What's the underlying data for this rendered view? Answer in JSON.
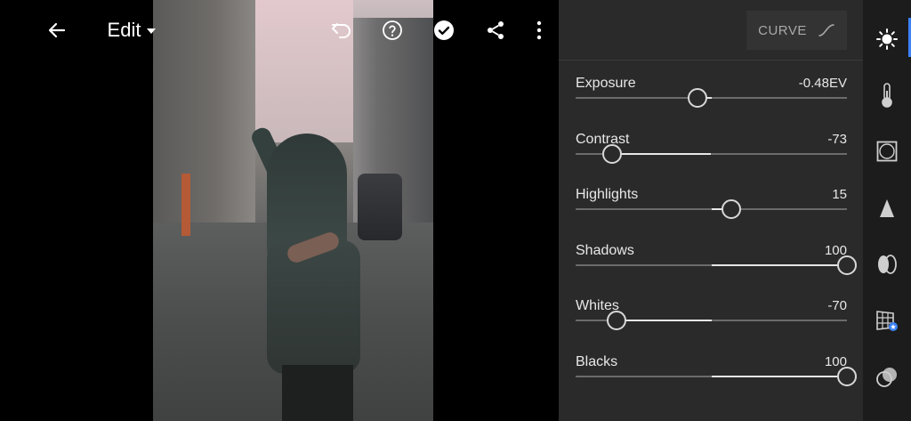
{
  "topbar": {
    "mode_label": "Edit"
  },
  "panel": {
    "curve_label": "CURVE",
    "sliders": [
      {
        "label": "Exposure",
        "value_text": "-0.48EV",
        "position": 0.45
      },
      {
        "label": "Contrast",
        "value_text": "-73",
        "position": 0.135
      },
      {
        "label": "Highlights",
        "value_text": "15",
        "position": 0.575
      },
      {
        "label": "Shadows",
        "value_text": "100",
        "position": 1.0
      },
      {
        "label": "Whites",
        "value_text": "-70",
        "position": 0.15
      },
      {
        "label": "Blacks",
        "value_text": "100",
        "position": 1.0
      }
    ]
  },
  "tools": [
    {
      "name": "light-icon",
      "active": true
    },
    {
      "name": "color-temperature-icon",
      "active": false
    },
    {
      "name": "effects-vignette-icon",
      "active": false
    },
    {
      "name": "detail-sharpen-icon",
      "active": false
    },
    {
      "name": "optics-lens-icon",
      "active": false
    },
    {
      "name": "geometry-icon",
      "active": false
    },
    {
      "name": "presets-icon",
      "active": false
    }
  ],
  "colors": {
    "panel_bg": "#2a2a2a",
    "toolstrip_bg": "#1c1c1c",
    "accent": "#3b82f6"
  }
}
